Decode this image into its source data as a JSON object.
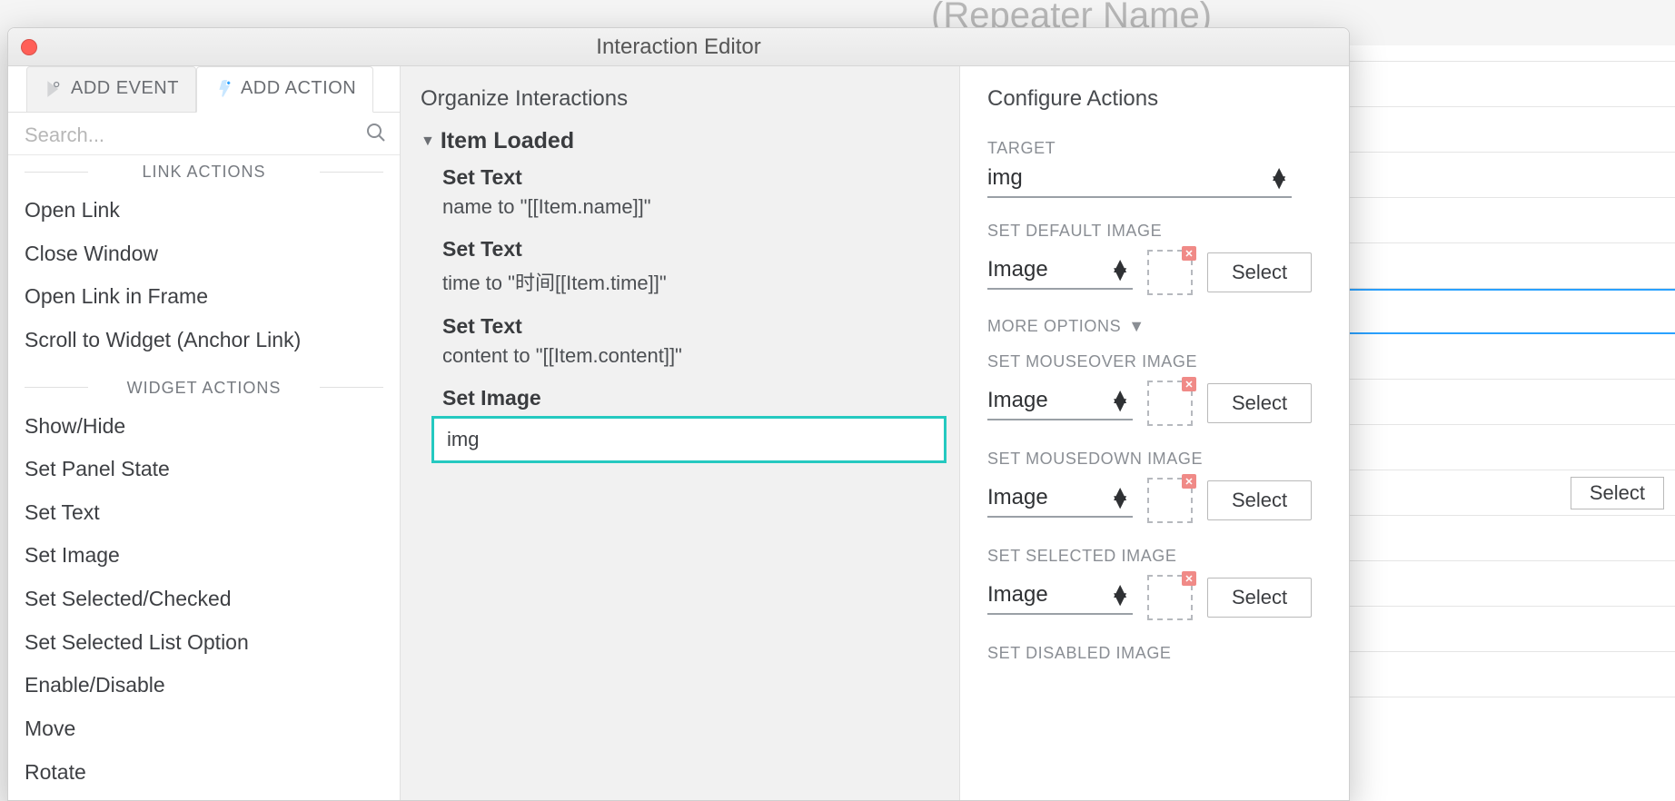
{
  "background": {
    "repeater_placeholder": "(Repeater Name)",
    "select_label": "Select"
  },
  "dialog_title": "Interaction Editor",
  "tabs": {
    "add_event": "ADD EVENT",
    "add_action": "ADD ACTION"
  },
  "search": {
    "placeholder": "Search..."
  },
  "groups": {
    "link_actions": "LINK ACTIONS",
    "widget_actions": "WIDGET ACTIONS"
  },
  "link_actions": {
    "open_link": "Open Link",
    "close_window": "Close Window",
    "open_link_in_frame": "Open Link in Frame",
    "scroll_to_widget": "Scroll to Widget (Anchor Link)"
  },
  "widget_actions": {
    "show_hide": "Show/Hide",
    "set_panel_state": "Set Panel State",
    "set_text": "Set Text",
    "set_image": "Set Image",
    "set_selected_checked": "Set Selected/Checked",
    "set_selected_list_option": "Set Selected List Option",
    "enable_disable": "Enable/Disable",
    "move": "Move",
    "rotate": "Rotate"
  },
  "organize": {
    "title": "Organize Interactions",
    "event": "Item Loaded",
    "actions": {
      "a1": {
        "name": "Set Text",
        "desc": "name to \"[[Item.name]]\""
      },
      "a2": {
        "name": "Set Text",
        "desc": "time to \"时间[[Item.time]]\""
      },
      "a3": {
        "name": "Set Text",
        "desc": "content to \"[[Item.content]]\""
      },
      "a4": {
        "name": "Set Image",
        "desc": "img"
      }
    }
  },
  "configure": {
    "title": "Configure Actions",
    "target_label": "TARGET",
    "target_value": "img",
    "image_option": "Image",
    "more_options": "MORE OPTIONS",
    "sections": {
      "default": "SET DEFAULT IMAGE",
      "mouseover": "SET MOUSEOVER IMAGE",
      "mousedown": "SET MOUSEDOWN IMAGE",
      "selected": "SET SELECTED IMAGE",
      "disabled": "SET DISABLED IMAGE"
    },
    "select_btn": "Select"
  }
}
